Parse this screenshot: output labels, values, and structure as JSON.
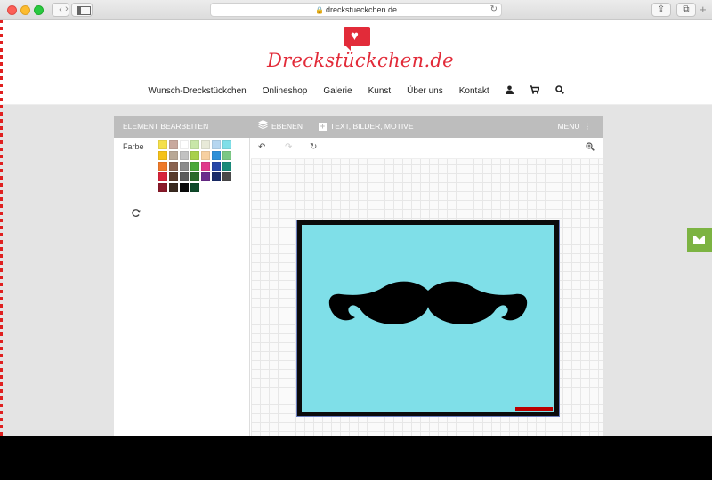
{
  "browser": {
    "url": "dreckstueckchen.de"
  },
  "site": {
    "logo_text": "Dreckstückchen.de",
    "nav": [
      {
        "label": "Wunsch-Dreckstückchen"
      },
      {
        "label": "Onlineshop"
      },
      {
        "label": "Galerie"
      },
      {
        "label": "Kunst"
      },
      {
        "label": "Über uns"
      },
      {
        "label": "Kontakt"
      }
    ],
    "nav_icons": [
      "user-icon",
      "cart-icon",
      "search-icon"
    ]
  },
  "designer": {
    "toolbar": {
      "edit_label": "ELEMENT BEARBEITEN",
      "layers_label": "EBENEN",
      "add_label": "TEXT, BILDER, MOTIVE",
      "menu_label": "MENU"
    },
    "color_label": "Farbe",
    "palette": [
      "#f5e04a",
      "#c9a99e",
      "#ffffff",
      "#c8e6a8",
      "#e8ead8",
      "#b6d6f0",
      "#7fdfe8",
      "#f5c219",
      "#b9a896",
      "#c2c2c2",
      "#a8d04a",
      "#f7d0a0",
      "#2f90d8",
      "#7bc885",
      "#ef7a2a",
      "#8a6350",
      "#8c8c8c",
      "#4aa83a",
      "#e03a8c",
      "#2747a8",
      "#1a8a7a",
      "#d8233a",
      "#5a3b2b",
      "#5e5e5e",
      "#2a6a2a",
      "#6b2c8c",
      "#1b2d6b",
      "#4a4a4a",
      "#8a1a2a",
      "#3a2a20",
      "#0a0a0a",
      "#0f4a2a"
    ],
    "canvas_tools": [
      "undo-icon",
      "redo-icon",
      "refresh-icon",
      "zoom-in-icon"
    ],
    "print_color": "#7fdfe8"
  }
}
